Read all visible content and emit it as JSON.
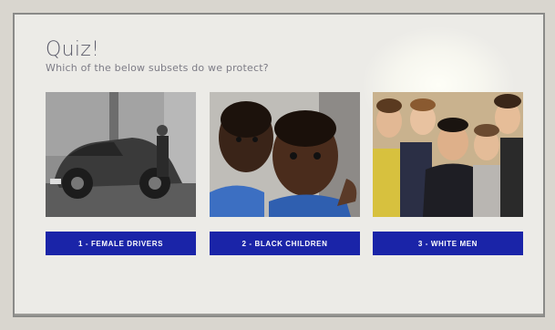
{
  "quiz": {
    "title": "Quiz!",
    "question": "Which of the below subsets do we protect?"
  },
  "options": [
    {
      "label": "1 - FEMALE DRIVERS",
      "image": "vintage-car-photo"
    },
    {
      "label": "2 - BLACK CHILDREN",
      "image": "children-photo"
    },
    {
      "label": "3 - WHITE MEN",
      "image": "group-of-men-photo"
    }
  ],
  "colors": {
    "button": "#1a24a8",
    "screen_bg": "#ecebe7",
    "title_text": "#5b5b6a"
  }
}
